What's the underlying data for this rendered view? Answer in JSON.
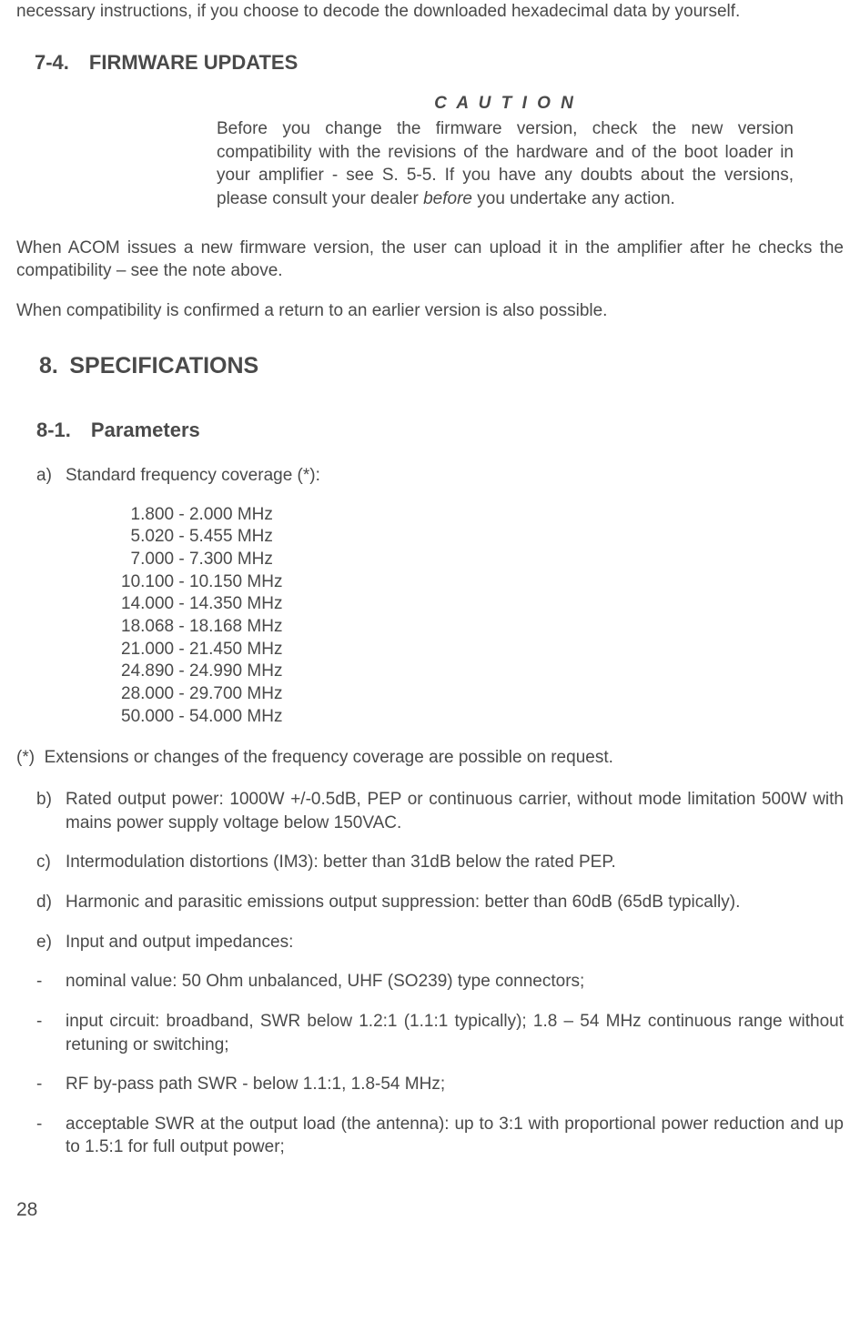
{
  "intro": "necessary instructions, if you choose to decode the downloaded hexadecimal data by yourself.",
  "s74": {
    "heading": "7-4. FIRMWARE UPDATES",
    "caution_title": "C A U T I O N",
    "caution_text_before": "Before you change the firmware version, check the new version compatibility with the revisions of the hardware and of the boot loader in your amplifier - see S. 5-5. If you have any doubts about the versions, please consult your dealer ",
    "caution_italic": "before",
    "caution_text_after": " you undertake any action."
  },
  "p1": "When ACOM issues a new firmware version, the user can upload it in the amplifier after he checks the compatibility – see the note above.",
  "p2": "When compatibility is confirmed a return to an earlier version is also possible.",
  "s8": {
    "heading": "8. SPECIFICATIONS"
  },
  "s81": {
    "heading": "8-1. Parameters",
    "a_label": "a)",
    "a_text": "Standard frequency coverage (*):",
    "freq": [
      "  1.800 - 2.000 MHz",
      "  5.020 - 5.455 MHz",
      "  7.000 - 7.300 MHz",
      "10.100 - 10.150 MHz",
      "14.000 - 14.350 MHz",
      "18.068 - 18.168 MHz",
      "21.000 - 21.450 MHz",
      "24.890 - 24.990 MHz",
      "28.000 - 29.700 MHz",
      "50.000 - 54.000 MHz"
    ],
    "footnote": "(*)  Extensions or changes of the frequency coverage are possible on request.",
    "b_label": "b)",
    "b_text": "Rated output power: 1000W   +/-0.5dB, PEP or continuous carrier, without mode limitation 500W with mains power supply voltage below 150VAC.",
    "c_label": "c)",
    "c_text": "Intermodulation distortions (IM3): better than 31dB below the rated PEP.",
    "d_label": "d)",
    "d_text": "Harmonic and parasitic emissions output suppression: better than 60dB (65dB typically).",
    "e_label": "e)",
    "e_text": "Input and output impedances:",
    "dash1": "nominal value: 50 Ohm unbalanced, UHF (SO239) type connectors;",
    "dash2": "input circuit: broadband, SWR below 1.2:1 (1.1:1 typically); 1.8 – 54 MHz continuous range without retuning or switching;",
    "dash3": "RF by-pass path SWR - below 1.1:1, 1.8-54 MHz;",
    "dash4": "acceptable SWR at the output load (the antenna): up to 3:1 with proportional power reduction and up to 1.5:1 for full output power;"
  },
  "page_number": "28"
}
